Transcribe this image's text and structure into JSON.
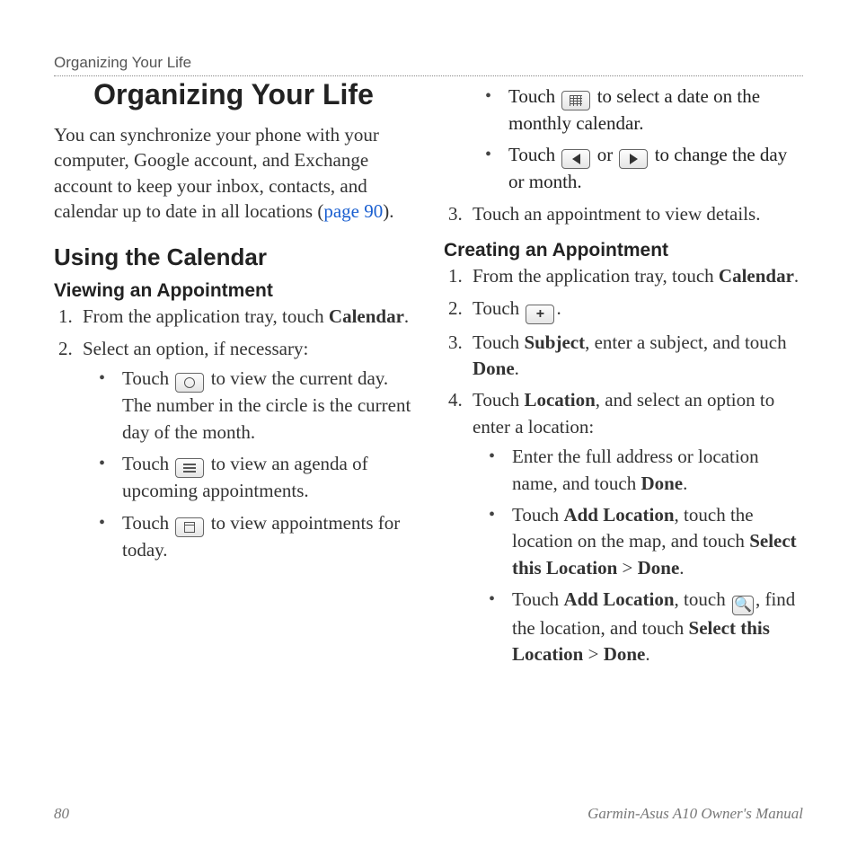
{
  "running_head": "Organizing Your Life",
  "title": "Organizing Your Life",
  "intro_before_link": "You can synchronize your phone with your computer, Google account, and Exchange account to keep your inbox, contacts, and calendar up to date in all locations (",
  "intro_link": "page 90",
  "intro_after_link": ").",
  "h2_using_calendar": "Using the Calendar",
  "h3_viewing": "Viewing an Appointment",
  "viewing_steps": {
    "s1_a": "From the application tray, touch ",
    "s1_b": "Calendar",
    "s1_c": ".",
    "s2": "Select an option, if necessary:",
    "opt1_a": "Touch ",
    "opt1_b": " to view the current day. The number in the circle is the current day of the month.",
    "opt2_a": "Touch ",
    "opt2_b": " to view an agenda of upcoming appointments.",
    "opt3_a": "Touch ",
    "opt3_b": " to view appointments for today.",
    "opt4_a": "Touch ",
    "opt4_b": " to select a date on the monthly calendar.",
    "opt5_a": "Touch ",
    "opt5_mid": " or ",
    "opt5_b": " to change the day or month.",
    "s3": "Touch an appointment to view details."
  },
  "h3_creating": "Creating an Appointment",
  "creating_steps": {
    "s1_a": "From the application tray, touch ",
    "s1_b": "Calendar",
    "s1_c": ".",
    "s2_a": "Touch ",
    "s2_b": ".",
    "s3_a": "Touch ",
    "s3_b": "Subject",
    "s3_c": ", enter a subject, and touch ",
    "s3_d": "Done",
    "s3_e": ".",
    "s4_a": "Touch ",
    "s4_b": "Location",
    "s4_c": ", and select an option to enter a location:",
    "loc1_a": "Enter the full address or location name, and touch ",
    "loc1_b": "Done",
    "loc1_c": ".",
    "loc2_a": "Touch ",
    "loc2_b": "Add Location",
    "loc2_c": ", touch the location on the map, and touch ",
    "loc2_d": "Select this Location",
    "loc2_e": " > ",
    "loc2_f": "Done",
    "loc2_g": ".",
    "loc3_a": "Touch ",
    "loc3_b": "Add Location",
    "loc3_c": ", touch ",
    "loc3_d": ", find the location, and touch ",
    "loc3_e": "Select this Location",
    "loc3_f": " > ",
    "loc3_g": "Done",
    "loc3_h": "."
  },
  "icons": {
    "day_circle": "◯",
    "search": "🔍"
  },
  "footer": {
    "page_number": "80",
    "manual_title": "Garmin-Asus A10 Owner's Manual"
  }
}
